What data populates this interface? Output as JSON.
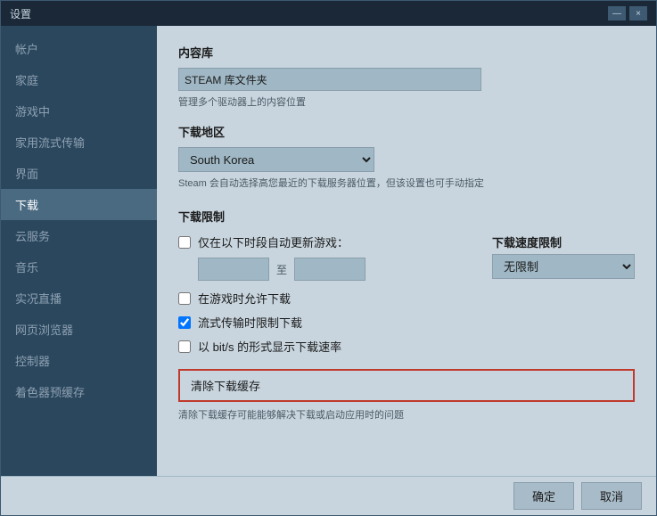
{
  "window": {
    "title": "设置",
    "close_btn": "×",
    "minimize_btn": "—"
  },
  "sidebar": {
    "items": [
      {
        "id": "account",
        "label": "帐户",
        "active": false
      },
      {
        "id": "family",
        "label": "家庭",
        "active": false
      },
      {
        "id": "ingame",
        "label": "游戏中",
        "active": false
      },
      {
        "id": "streaming",
        "label": "家用流式传输",
        "active": false
      },
      {
        "id": "interface",
        "label": "界面",
        "active": false
      },
      {
        "id": "download",
        "label": "下载",
        "active": true
      },
      {
        "id": "cloud",
        "label": "云服务",
        "active": false
      },
      {
        "id": "music",
        "label": "音乐",
        "active": false
      },
      {
        "id": "broadcast",
        "label": "实况直播",
        "active": false
      },
      {
        "id": "browser",
        "label": "网页浏览器",
        "active": false
      },
      {
        "id": "controller",
        "label": "控制器",
        "active": false
      },
      {
        "id": "shader",
        "label": "着色器预缓存",
        "active": false
      }
    ]
  },
  "main": {
    "content_library": {
      "title": "内容库",
      "field_value": "STEAM 库文件夹",
      "hint": "管理多个驱动器上的内容位置"
    },
    "download_region": {
      "title": "下载地区",
      "selected": "South Korea",
      "hint": "Steam 会自动选择高您最近的下载服务器位置，但该设置也可手动指定"
    },
    "download_limit": {
      "title": "下载限制",
      "auto_update_label": "仅在以下时段自动更新游戏：",
      "to_label": "至",
      "speed_limit_label": "下载速度限制",
      "speed_value": "无限制",
      "allow_ingame_label": "在游戏时允许下载",
      "streaming_limit_label": "流式传输时限制下载",
      "bitrate_label": "以 bit/s 的形式显示下载速率"
    },
    "cache": {
      "clear_btn_label": "清除下载缓存",
      "hint": "清除下载缓存可能能够解决下载或启动应用时的问题"
    }
  },
  "footer": {
    "confirm_label": "确定",
    "cancel_label": "取消"
  }
}
